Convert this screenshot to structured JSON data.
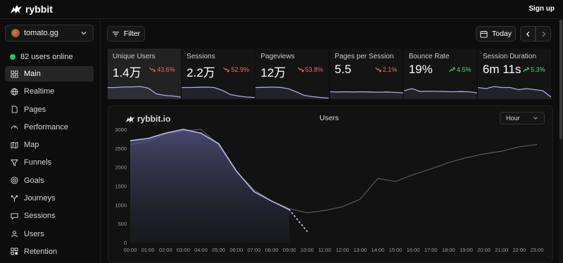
{
  "app": {
    "brand": "rybbit",
    "signup_label": "Sign up"
  },
  "sidebar": {
    "site": "tomato.gg",
    "online": "82 users online",
    "items": [
      {
        "label": "Main",
        "icon": "grid-icon",
        "active": true
      },
      {
        "label": "Realtime",
        "icon": "globe-icon"
      },
      {
        "label": "Pages",
        "icon": "file-icon"
      },
      {
        "label": "Performance",
        "icon": "gauge-icon"
      },
      {
        "label": "Map",
        "icon": "map-icon"
      },
      {
        "label": "Funnels",
        "icon": "funnel-icon"
      },
      {
        "label": "Goals",
        "icon": "target-icon"
      },
      {
        "label": "Journeys",
        "icon": "split-icon"
      },
      {
        "label": "Sessions",
        "icon": "sessions-icon"
      },
      {
        "label": "Users",
        "icon": "user-icon"
      },
      {
        "label": "Retention",
        "icon": "retention-icon"
      }
    ]
  },
  "toolbar": {
    "filter_label": "Filter",
    "date_label": "Today"
  },
  "stats": [
    {
      "label": "Unique Users",
      "value": "1.4万",
      "change": "43.6%",
      "trend": "down",
      "spark": [
        0.55,
        0.55,
        0.58,
        0.58,
        0.6,
        0.52,
        0.25,
        0.18,
        0.15,
        0.1
      ]
    },
    {
      "label": "Sessions",
      "value": "2.2万",
      "change": "52.9%",
      "trend": "down",
      "spark": [
        0.55,
        0.55,
        0.56,
        0.57,
        0.55,
        0.42,
        0.22,
        0.15,
        0.1,
        0.08
      ]
    },
    {
      "label": "Pageviews",
      "value": "12万",
      "change": "53.8%",
      "trend": "down",
      "spark": [
        0.55,
        0.56,
        0.57,
        0.56,
        0.5,
        0.35,
        0.18,
        0.12,
        0.08,
        0.05
      ]
    },
    {
      "label": "Pages per Session",
      "value": "5.5",
      "change": "2.1%",
      "trend": "down",
      "spark": [
        0.35,
        0.34,
        0.35,
        0.34,
        0.35,
        0.34,
        0.33,
        0.34,
        0.32,
        0.3
      ]
    },
    {
      "label": "Bounce Rate",
      "value": "19%",
      "change": "4.5%",
      "trend": "up",
      "spark": [
        0.4,
        0.5,
        0.36,
        0.38,
        0.37,
        0.36,
        0.35,
        0.36,
        0.35,
        0.3
      ]
    },
    {
      "label": "Session Duration",
      "value": "6m 11s",
      "change": "5.3%",
      "trend": "up",
      "spark": [
        0.55,
        0.5,
        0.6,
        0.55,
        0.55,
        0.45,
        0.5,
        0.45,
        0.4,
        0.1
      ]
    }
  ],
  "chart_data": {
    "type": "line",
    "title": "Users",
    "logo_text": "rybbit.io",
    "granularity": "Hour",
    "x": [
      "00:00",
      "01:00",
      "02:00",
      "03:00",
      "04:00",
      "05:00",
      "06:00",
      "07:00",
      "08:00",
      "09:00",
      "10:00",
      "11:00",
      "12:00",
      "13:00",
      "14:00",
      "15:00",
      "16:00",
      "17:00",
      "18:00",
      "19:00",
      "20:00",
      "21:00",
      "22:00",
      "23:00"
    ],
    "ylim": [
      0,
      3000
    ],
    "yticks": [
      0,
      500,
      1000,
      1500,
      2000,
      2500,
      3000
    ],
    "series": [
      {
        "role": "current",
        "color": "#b8b9ef",
        "values": [
          2700,
          2760,
          2900,
          3000,
          2900,
          2620,
          1900,
          1350,
          1100,
          870,
          300
        ],
        "dashed_from": 9
      },
      {
        "role": "previous",
        "color": "#595959",
        "values": [
          2600,
          2680,
          2880,
          2960,
          3000,
          2600,
          1880,
          1400,
          1100,
          900,
          790,
          850,
          950,
          1150,
          1700,
          1620,
          1800,
          1950,
          2120,
          2250,
          2350,
          2420,
          2540,
          2600
        ]
      }
    ]
  }
}
